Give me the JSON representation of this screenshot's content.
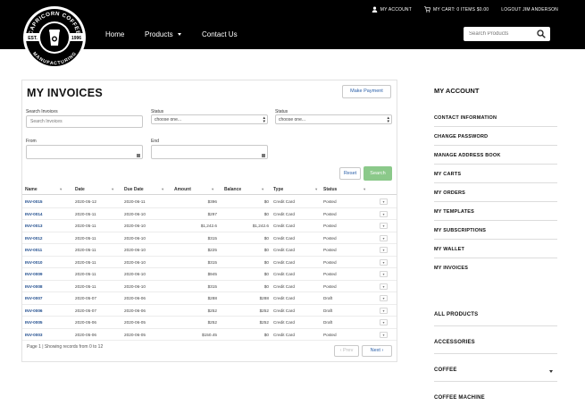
{
  "topbar": {
    "account": "MY ACCOUNT",
    "cart": "MY CART: 0 ITEMS  $0.00",
    "logout": "LOGOUT JIM ANDERSON"
  },
  "brand": {
    "top_text": "CAPRICORN COFFEE",
    "bottom_text": "MANUFACTURING",
    "est": "EST.",
    "year": "1996"
  },
  "nav": {
    "items": [
      "Home",
      "Products",
      "Contact Us"
    ],
    "search_placeholder": "Search Products"
  },
  "invoices": {
    "title": "MY INVOICES",
    "make_payment": "Make Payment",
    "filters": {
      "search_label": "Search Invoices",
      "search_placeholder": "Search Invoices",
      "status1_label": "Status",
      "status1_value": "choose one...",
      "status2_label": "Status",
      "status2_value": "choose one...",
      "from_label": "From",
      "end_label": "End"
    },
    "reset_label": "Reset",
    "search_label": "Search",
    "columns": [
      "Name",
      "Date",
      "Due Date",
      "Amount",
      "Balance",
      "Type",
      "Status"
    ],
    "rows": [
      [
        "INV-0015",
        "2020-05-12",
        "2020-06-11",
        "$396",
        "$0",
        "Credit Card",
        "Posted"
      ],
      [
        "INV-0014",
        "2020-05-11",
        "2020-06-10",
        "$297",
        "$0",
        "Credit Card",
        "Posted"
      ],
      [
        "INV-0013",
        "2020-05-11",
        "2020-06-10",
        "$1,242.6",
        "$1,242.6",
        "Credit Card",
        "Posted"
      ],
      [
        "INV-0012",
        "2020-05-11",
        "2020-06-10",
        "$315",
        "$0",
        "Credit Card",
        "Posted"
      ],
      [
        "INV-0011",
        "2020-05-11",
        "2020-06-10",
        "$225",
        "$0",
        "Credit Card",
        "Posted"
      ],
      [
        "INV-0010",
        "2020-05-11",
        "2020-06-10",
        "$315",
        "$0",
        "Credit Card",
        "Posted"
      ],
      [
        "INV-0009",
        "2020-05-11",
        "2020-06-10",
        "$945",
        "$0",
        "Credit Card",
        "Posted"
      ],
      [
        "INV-0008",
        "2020-05-11",
        "2020-06-10",
        "$315",
        "$0",
        "Credit Card",
        "Posted"
      ],
      [
        "INV-0007",
        "2020-05-07",
        "2020-06-06",
        "$288",
        "$288",
        "Credit Card",
        "Draft"
      ],
      [
        "INV-0006",
        "2020-05-07",
        "2020-06-06",
        "$252",
        "$252",
        "Credit Card",
        "Draft"
      ],
      [
        "INV-0005",
        "2020-05-06",
        "2020-06-05",
        "$252",
        "$252",
        "Credit Card",
        "Draft"
      ],
      [
        "INV-0003",
        "2020-05-06",
        "2020-06-05",
        "$150.45",
        "$0",
        "Credit Card",
        "Posted"
      ]
    ],
    "footer": "Page 1 | Showing records from 0 to 12",
    "prev": "‹ Prev",
    "next": "Next ›"
  },
  "sidebar": {
    "title": "MY ACCOUNT",
    "links": [
      "CONTACT INFORMATION",
      "CHANGE PASSWORD",
      "MANAGE ADDRESS BOOK",
      "MY CARTS",
      "MY ORDERS",
      "MY TEMPLATES",
      "MY SUBSCRIPTIONS",
      "MY WALLET",
      "MY INVOICES"
    ],
    "categories": [
      "ALL PRODUCTS",
      "ACCESSORIES",
      "COFFEE",
      "COFFEE MACHINE"
    ]
  },
  "colors": {
    "header_bg": "#000000",
    "link_blue": "#24508f",
    "search_green": "#8bc98a"
  }
}
